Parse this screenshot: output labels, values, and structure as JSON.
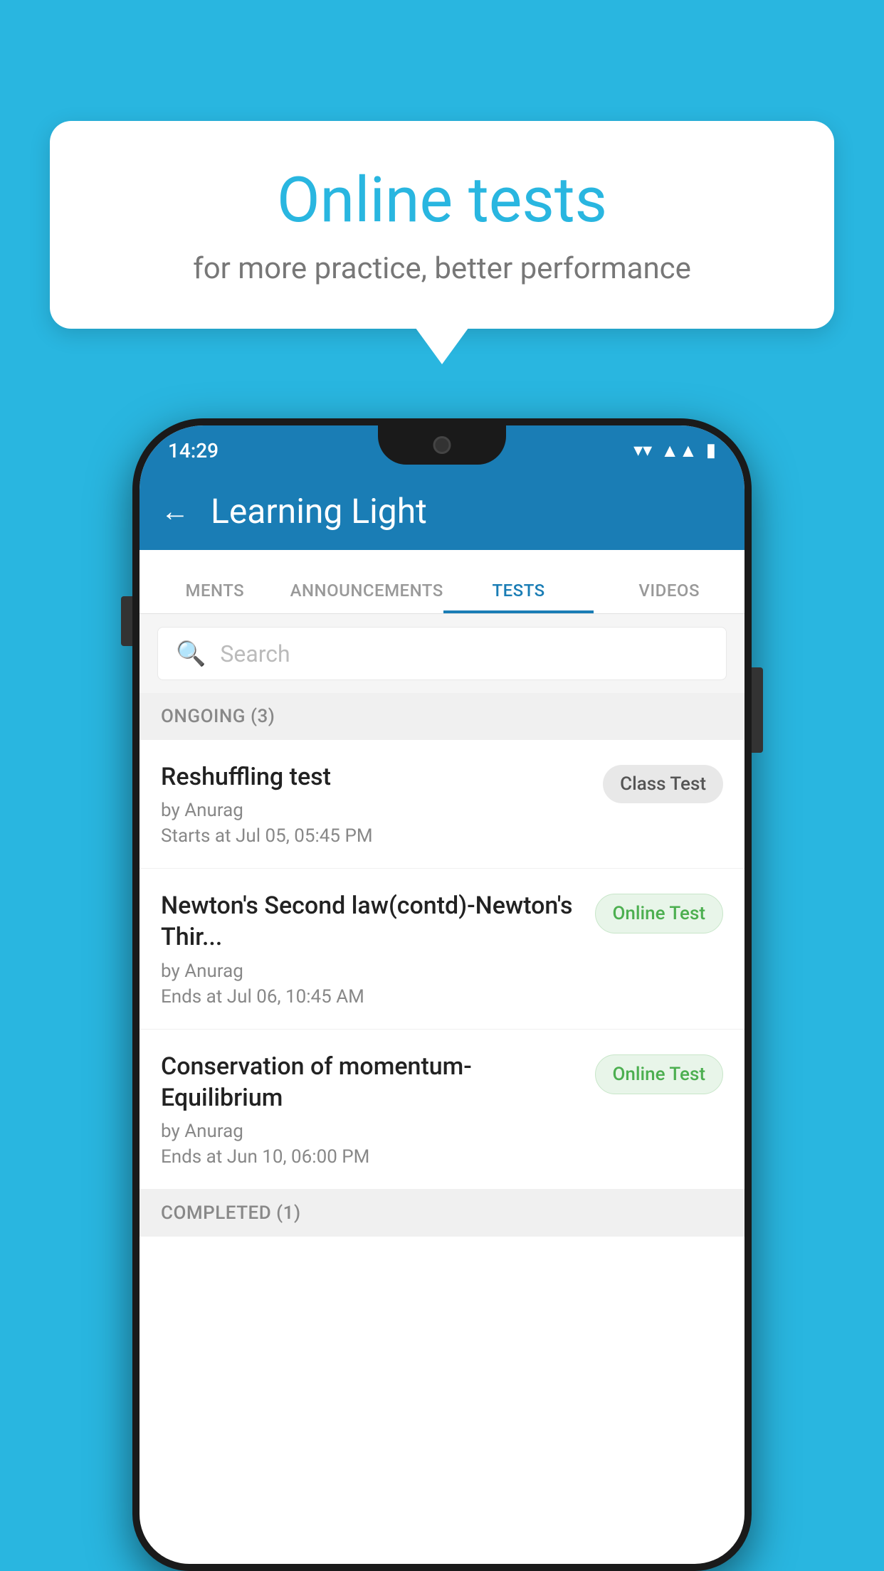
{
  "background": {
    "color": "#29b6e0"
  },
  "speech_bubble": {
    "title": "Online tests",
    "subtitle": "for more practice, better performance"
  },
  "status_bar": {
    "time": "14:29",
    "wifi": "▾",
    "signal": "▲",
    "battery": "▮"
  },
  "app_bar": {
    "back_label": "←",
    "title": "Learning Light"
  },
  "tabs": [
    {
      "label": "MENTS",
      "active": false
    },
    {
      "label": "ANNOUNCEMENTS",
      "active": false
    },
    {
      "label": "TESTS",
      "active": true
    },
    {
      "label": "VIDEOS",
      "active": false
    }
  ],
  "search": {
    "placeholder": "Search"
  },
  "sections": [
    {
      "title": "ONGOING (3)",
      "items": [
        {
          "name": "Reshuffling test",
          "author": "by Anurag",
          "time_label": "Starts at",
          "time": "Jul 05, 05:45 PM",
          "badge": "Class Test",
          "badge_type": "class"
        },
        {
          "name": "Newton's Second law(contd)-Newton's Thir...",
          "author": "by Anurag",
          "time_label": "Ends at",
          "time": "Jul 06, 10:45 AM",
          "badge": "Online Test",
          "badge_type": "online"
        },
        {
          "name": "Conservation of momentum-Equilibrium",
          "author": "by Anurag",
          "time_label": "Ends at",
          "time": "Jun 10, 06:00 PM",
          "badge": "Online Test",
          "badge_type": "online"
        }
      ]
    }
  ],
  "completed_section": {
    "title": "COMPLETED (1)"
  }
}
